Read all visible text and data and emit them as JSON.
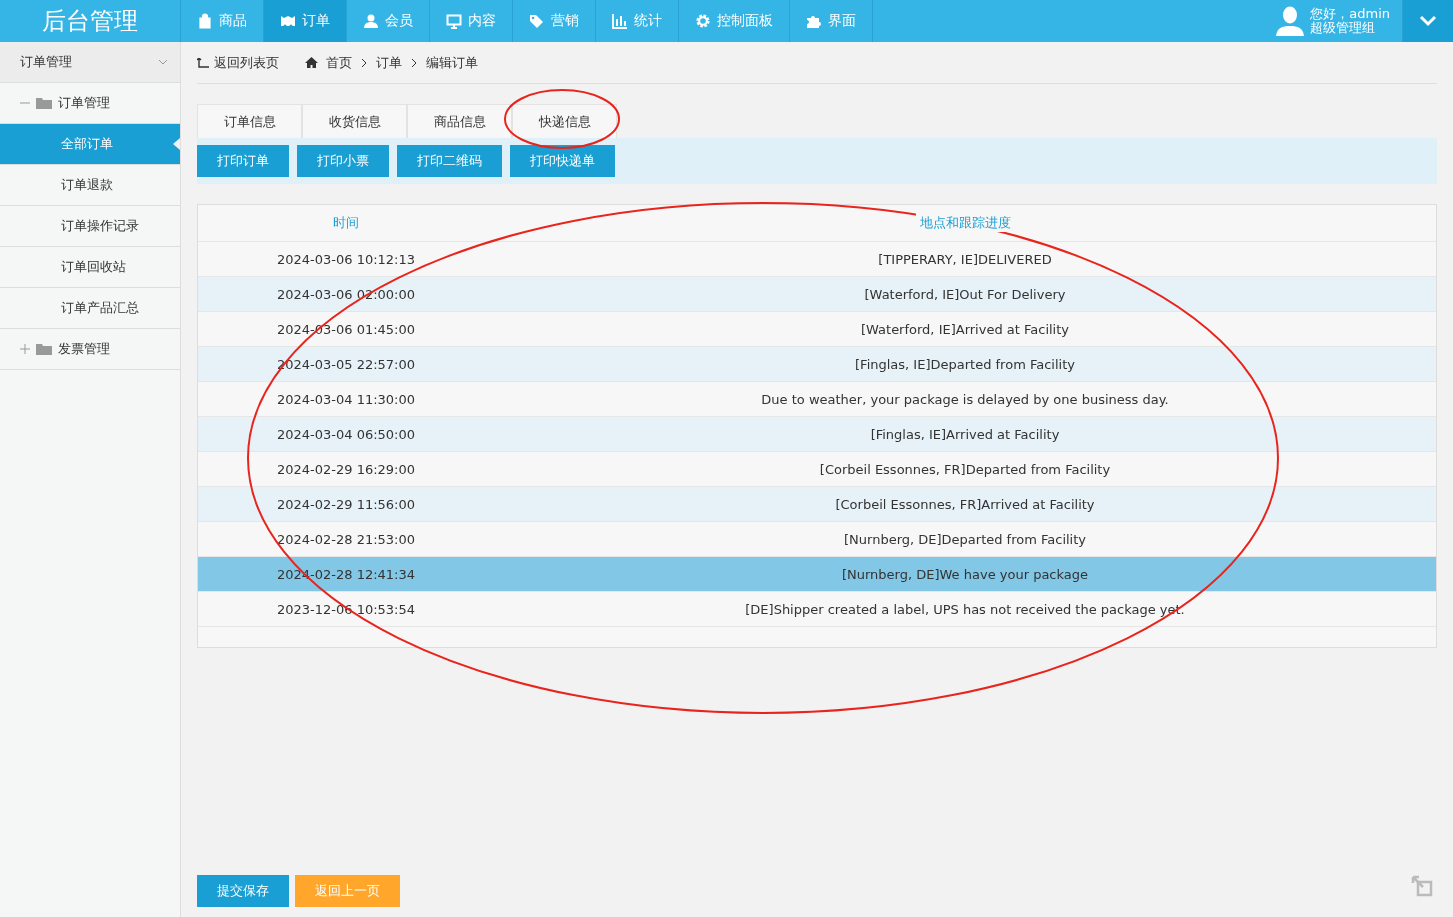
{
  "header": {
    "logo": "后台管理",
    "nav": [
      {
        "label": "商品",
        "selected": false
      },
      {
        "label": "订单",
        "selected": true
      },
      {
        "label": "会员",
        "selected": false
      },
      {
        "label": "内容",
        "selected": false
      },
      {
        "label": "营销",
        "selected": false
      },
      {
        "label": "统计",
        "selected": false
      },
      {
        "label": "控制面板",
        "selected": false
      },
      {
        "label": "界面",
        "selected": false
      }
    ],
    "user": {
      "greeting": "您好，admin",
      "role": "超级管理组"
    }
  },
  "sidebar": {
    "title": "订单管理",
    "groups": [
      {
        "label": "订单管理",
        "expanded": true,
        "children": [
          {
            "label": "全部订单",
            "selected": true
          },
          {
            "label": "订单退款",
            "selected": false
          },
          {
            "label": "订单操作记录",
            "selected": false
          },
          {
            "label": "订单回收站",
            "selected": false
          },
          {
            "label": "订单产品汇总",
            "selected": false
          }
        ]
      },
      {
        "label": "发票管理",
        "expanded": false
      }
    ]
  },
  "breadcrumb": {
    "back": "返回列表页",
    "items": [
      "首页",
      "订单",
      "编辑订单"
    ]
  },
  "tabs": [
    "订单信息",
    "收货信息",
    "商品信息",
    "快递信息"
  ],
  "print_buttons": [
    "打印订单",
    "打印小票",
    "打印二维码",
    "打印快递单"
  ],
  "table": {
    "columns": [
      "时间",
      "地点和跟踪进度"
    ],
    "rows": [
      {
        "time": "2024-03-06 10:12:13",
        "event": "[TIPPERARY, IE]DELIVERED",
        "selected": false
      },
      {
        "time": "2024-03-06 02:00:00",
        "event": "[Waterford, IE]Out For Delivery",
        "selected": false
      },
      {
        "time": "2024-03-06 01:45:00",
        "event": "[Waterford, IE]Arrived at Facility",
        "selected": false
      },
      {
        "time": "2024-03-05 22:57:00",
        "event": "[Finglas, IE]Departed from Facility",
        "selected": false
      },
      {
        "time": "2024-03-04 11:30:00",
        "event": "Due to weather, your package is delayed by one business day.",
        "selected": false
      },
      {
        "time": "2024-03-04 06:50:00",
        "event": "[Finglas, IE]Arrived at Facility",
        "selected": false
      },
      {
        "time": "2024-02-29 16:29:00",
        "event": "[Corbeil Essonnes, FR]Departed from Facility",
        "selected": false
      },
      {
        "time": "2024-02-29 11:56:00",
        "event": "[Corbeil Essonnes, FR]Arrived at Facility",
        "selected": false
      },
      {
        "time": "2024-02-28 21:53:00",
        "event": "[Nurnberg, DE]Departed from Facility",
        "selected": false
      },
      {
        "time": "2024-02-28 12:41:34",
        "event": "[Nurnberg, DE]We have your package",
        "selected": true
      },
      {
        "time": "2023-12-06 10:53:54",
        "event": "[DE]Shipper created a label, UPS has not received the package yet.",
        "selected": false
      }
    ]
  },
  "footer_buttons": [
    {
      "label": "提交保存",
      "kind": "primary"
    },
    {
      "label": "返回上一页",
      "kind": "secondary"
    }
  ]
}
